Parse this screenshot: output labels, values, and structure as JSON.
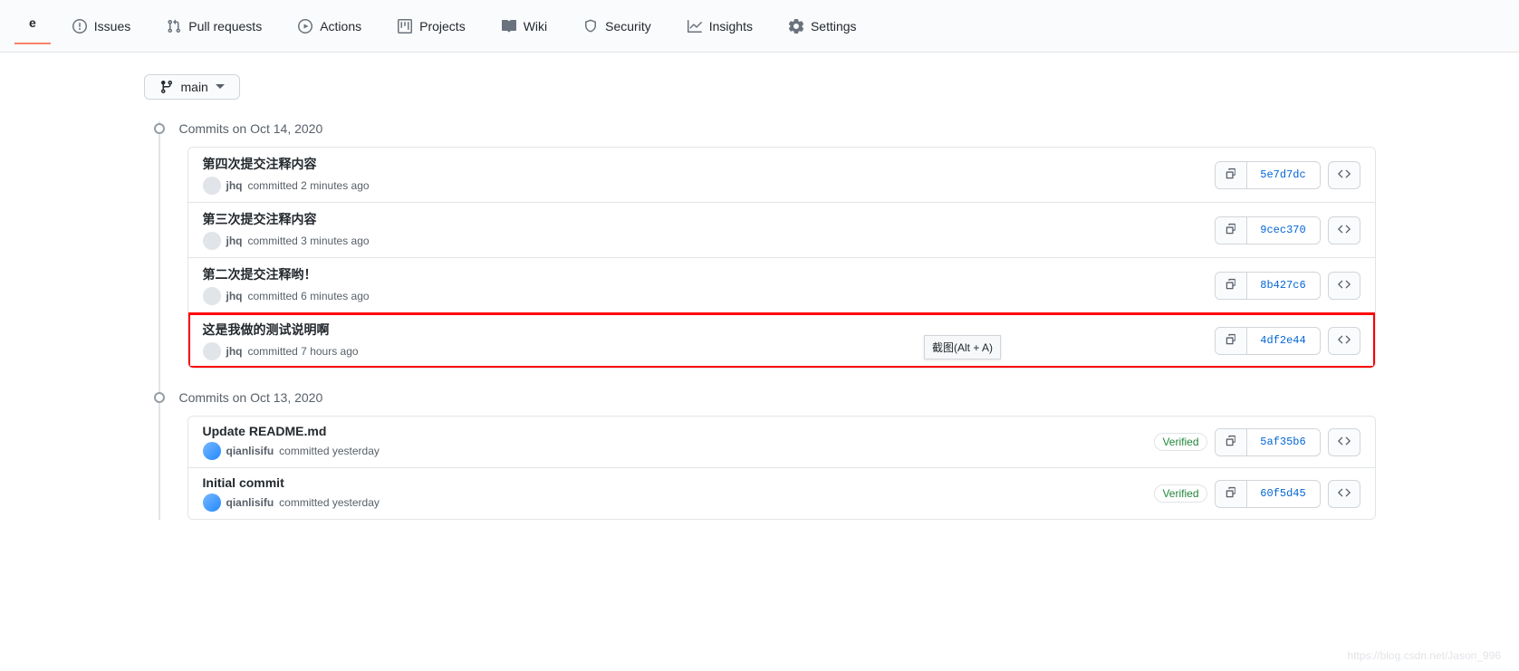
{
  "nav": {
    "code": "e",
    "issues": "Issues",
    "pull_requests": "Pull requests",
    "actions": "Actions",
    "projects": "Projects",
    "wiki": "Wiki",
    "security": "Security",
    "insights": "Insights",
    "settings": "Settings"
  },
  "branch": {
    "name": "main"
  },
  "tooltip": "截图(Alt + A)",
  "groups": [
    {
      "title": "Commits on Oct 14, 2020",
      "commits": [
        {
          "title": "第四次提交注释内容",
          "author": "jhq",
          "time": "committed 2 minutes ago",
          "hash": "5e7d7dc",
          "verified": false,
          "avatar": "user1",
          "highlighted": false
        },
        {
          "title": "第三次提交注释内容",
          "author": "jhq",
          "time": "committed 3 minutes ago",
          "hash": "9cec370",
          "verified": false,
          "avatar": "user1",
          "highlighted": false
        },
        {
          "title": "第二次提交注释哟！",
          "author": "jhq",
          "time": "committed 6 minutes ago",
          "hash": "8b427c6",
          "verified": false,
          "avatar": "user1",
          "highlighted": false
        },
        {
          "title": "这是我做的测试说明啊",
          "author": "jhq",
          "time": "committed 7 hours ago",
          "hash": "4df2e44",
          "verified": false,
          "avatar": "user1",
          "highlighted": true
        }
      ]
    },
    {
      "title": "Commits on Oct 13, 2020",
      "commits": [
        {
          "title": "Update README.md",
          "author": "qianlisifu",
          "time": "committed yesterday",
          "hash": "5af35b6",
          "verified": true,
          "avatar": "user2",
          "highlighted": false
        },
        {
          "title": "Initial commit",
          "author": "qianlisifu",
          "time": "committed yesterday",
          "hash": "60f5d45",
          "verified": true,
          "avatar": "user2",
          "highlighted": false
        }
      ]
    }
  ],
  "verified_label": "Verified",
  "watermark": "https://blog.csdn.net/Jason_996"
}
